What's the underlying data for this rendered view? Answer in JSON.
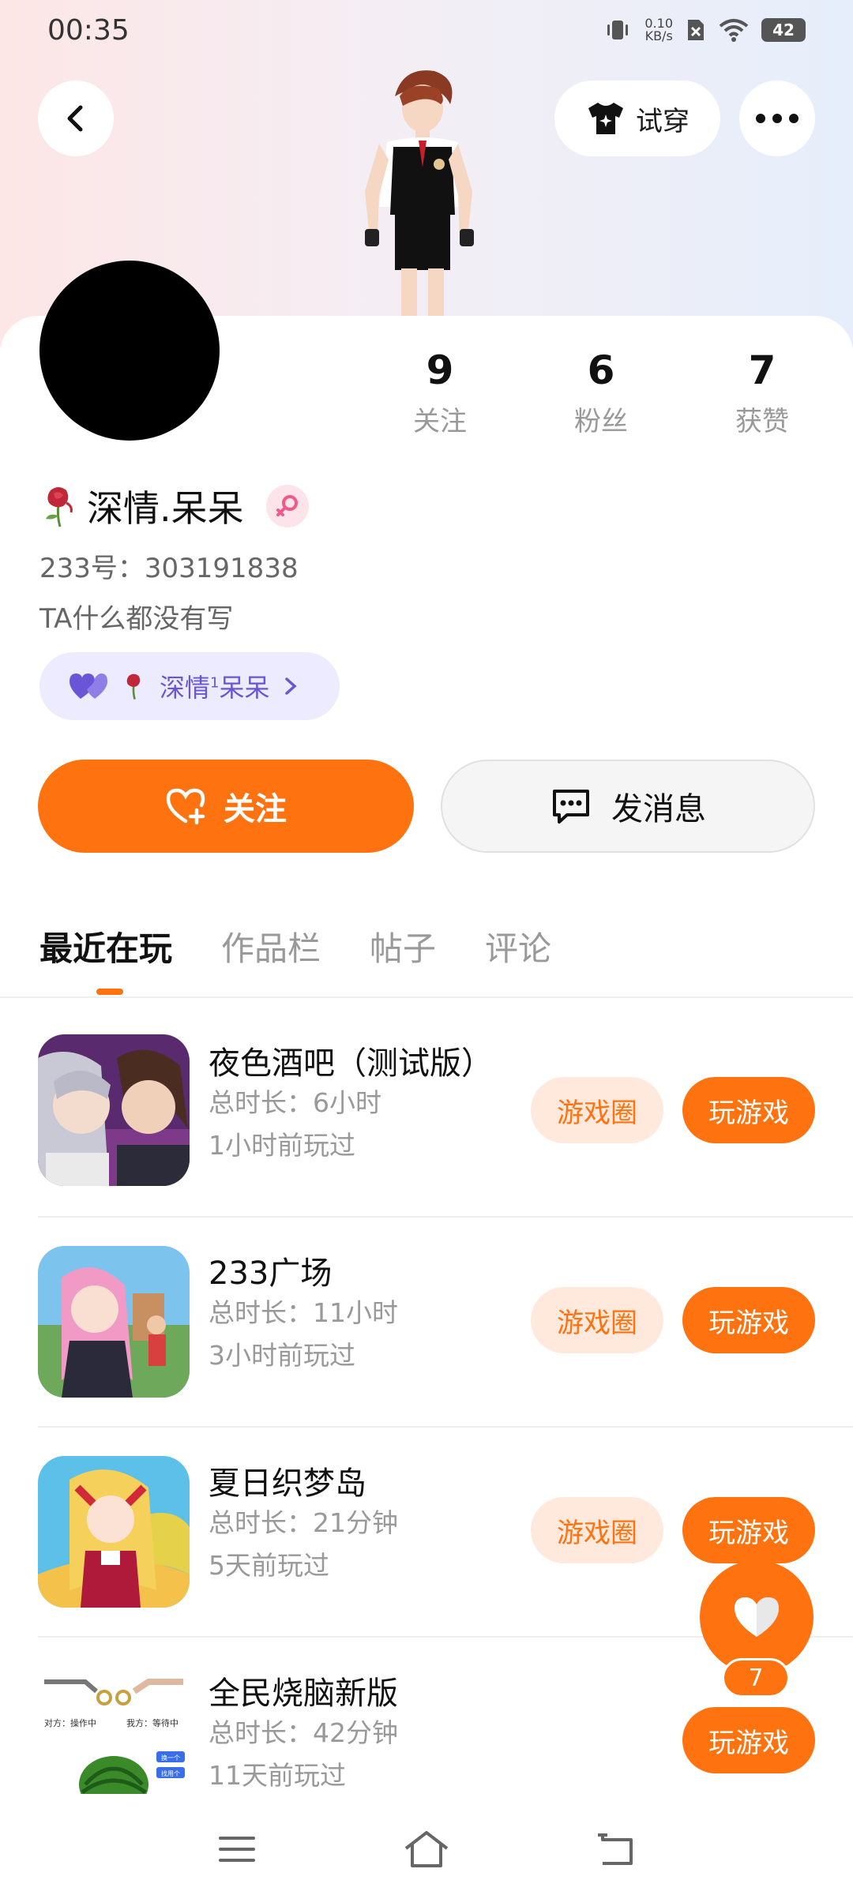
{
  "status_bar": {
    "time": "00:35",
    "net_speed_value": "0.10",
    "net_speed_unit": "KB/s",
    "battery": "42"
  },
  "header": {
    "tryon_label": "试穿"
  },
  "profile": {
    "stats": [
      {
        "value": "9",
        "label": "关注"
      },
      {
        "value": "6",
        "label": "粉丝"
      },
      {
        "value": "7",
        "label": "获赞"
      }
    ],
    "name": "深情.呆呆",
    "uid": "233号：303191838",
    "bio": "TA什么都没有写",
    "cp_tag": {
      "name_a": "深情",
      "superscript": "1",
      "name_b": "呆呆"
    }
  },
  "actions": {
    "follow_label": "关注",
    "message_label": "发消息"
  },
  "tabs": [
    "最近在玩",
    "作品栏",
    "帖子",
    "评论"
  ],
  "games": [
    {
      "title": "夜色酒吧（测试版）",
      "duration": "总时长：6小时",
      "last_played": "1小时前玩过",
      "circle_label": "游戏圈",
      "play_label": "玩游戏"
    },
    {
      "title": "233广场",
      "duration": "总时长：11小时",
      "last_played": "3小时前玩过",
      "circle_label": "游戏圈",
      "play_label": "玩游戏"
    },
    {
      "title": "夏日织梦岛",
      "duration": "总时长：21分钟",
      "last_played": "5天前玩过",
      "circle_label": "游戏圈",
      "play_label": "玩游戏"
    },
    {
      "title": "全民烧脑新版",
      "duration": "总时长：42分钟",
      "last_played": "11天前玩过",
      "play_label": "玩游戏"
    }
  ],
  "game4_thumb_text": {
    "left": "对方：操作中",
    "right": "我方：等待中",
    "btn1": "换一个",
    "btn2": "找用个"
  },
  "like_fab": {
    "count": "7"
  },
  "colors": {
    "accent": "#ff7210",
    "accent_light": "#ffe9dd",
    "cp_bg": "#ecebff"
  }
}
